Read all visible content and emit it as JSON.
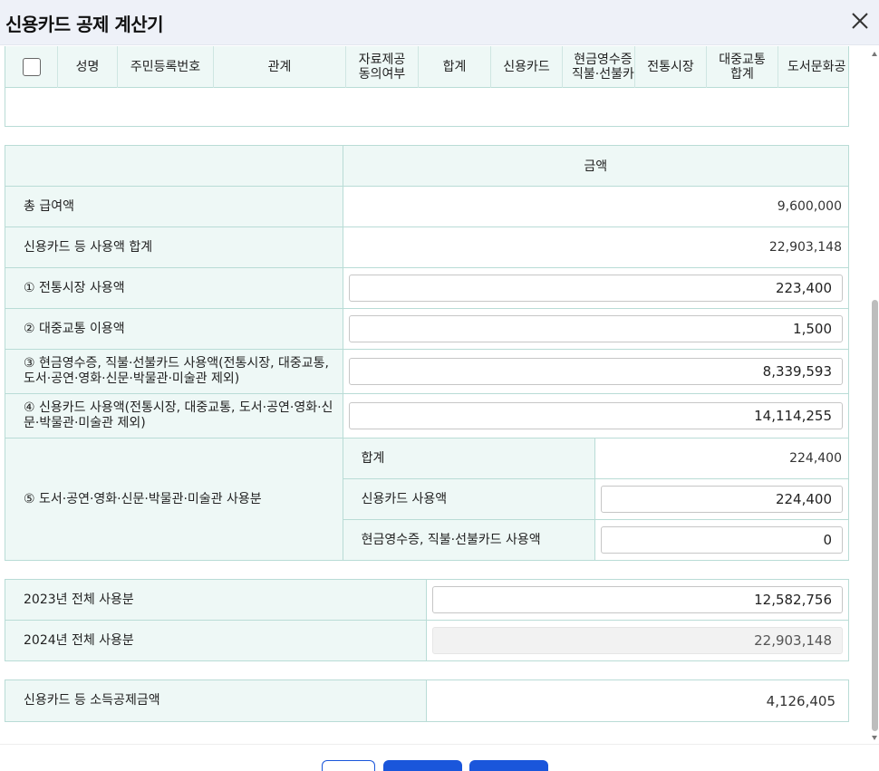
{
  "dialog": {
    "title": "신용카드 공제 계산기"
  },
  "grid": {
    "columns": [
      "성명",
      "주민등록번호",
      "관계",
      "자료제공\n동의여부",
      "합계",
      "신용카드",
      "현금영수증\n직불·선불카",
      "전통시장",
      "대중교통\n합계",
      "도서문화공"
    ]
  },
  "amounts": {
    "header": "금액",
    "rows": {
      "total_salary": {
        "label": "총 급여액",
        "value": "9,600,000"
      },
      "card_total": {
        "label": "신용카드 등 사용액 합계",
        "value": "22,903,148"
      },
      "market": {
        "label": "① 전통시장 사용액",
        "value": "223,400"
      },
      "transit": {
        "label": "② 대중교통 이용액",
        "value": "1,500"
      },
      "cash_receipt": {
        "label": "③ 현금영수증, 직불·선불카드 사용액(전통시장, 대중교통, 도서·공연·영화·신문·박물관·미술관 제외)",
        "value": "8,339,593"
      },
      "credit_card": {
        "label": "④ 신용카드 사용액(전통시장, 대중교통, 도서·공연·영화·신문·박물관·미술관 제외)",
        "value": "14,114,255"
      },
      "culture": {
        "label": "⑤ 도서·공연·영화·신문·박물관·미술관 사용분",
        "sum_label": "합계",
        "sum_value": "224,400",
        "card_label": "신용카드 사용액",
        "card_value": "224,400",
        "cash_label": "현금영수증, 직불·선불카드 사용액",
        "cash_value": "0"
      }
    }
  },
  "years": {
    "y2023": {
      "label": "2023년 전체 사용분",
      "value": "12,582,756"
    },
    "y2024": {
      "label": "2024년 전체 사용분",
      "value": "22,903,148"
    }
  },
  "deduction": {
    "label": "신용카드 등 소득공제금액",
    "value": "4,126,405"
  },
  "colors": {
    "header_bg": "#eef1f8",
    "cell_bg": "#eef8f6",
    "border": "#b9dcd6",
    "primary_button": "#1a56db"
  }
}
